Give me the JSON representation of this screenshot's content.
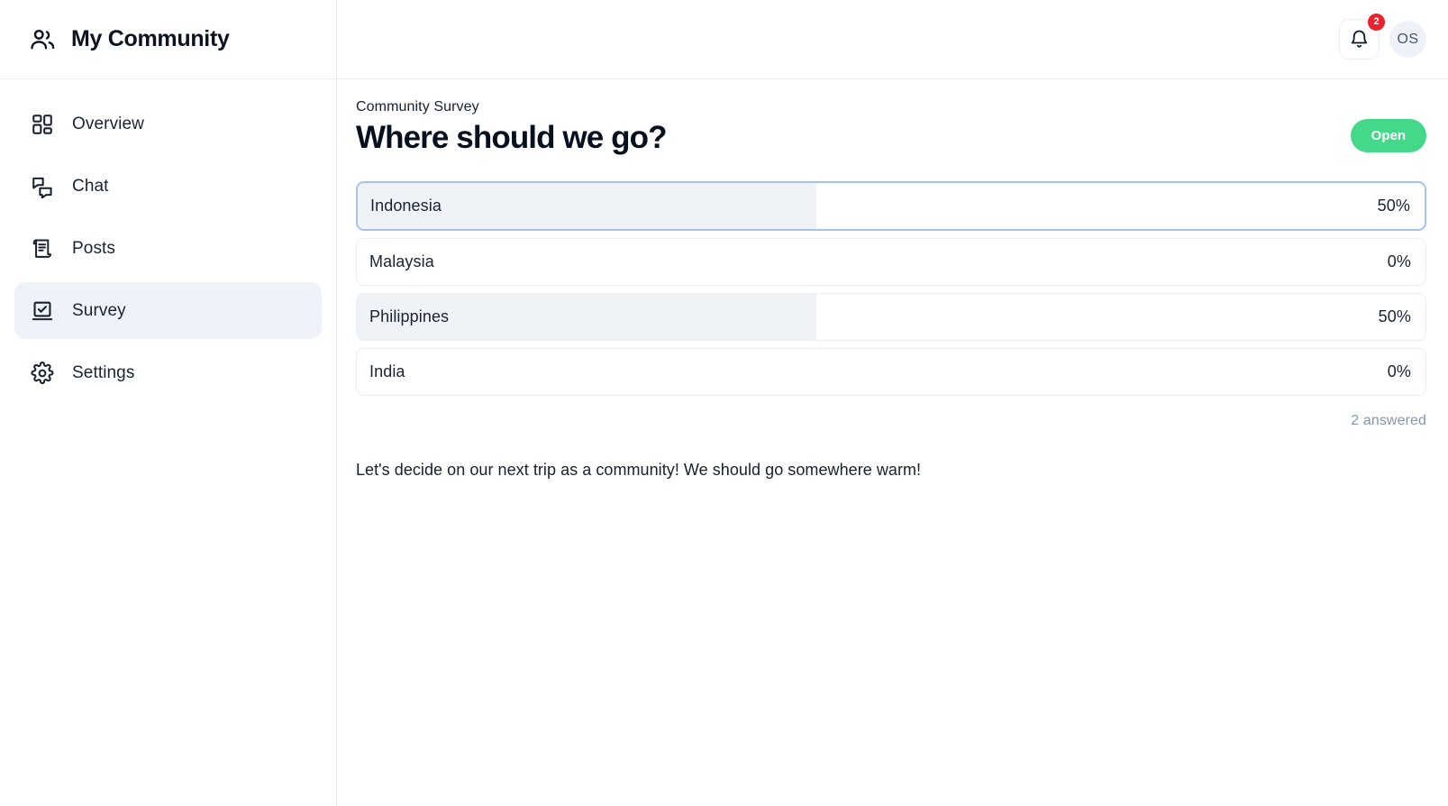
{
  "sidebar": {
    "brand": {
      "title": "My Community",
      "icon": "users-icon"
    },
    "items": [
      {
        "label": "Overview",
        "icon": "grid-icon",
        "active": false
      },
      {
        "label": "Chat",
        "icon": "chat-bubbles-icon",
        "active": false
      },
      {
        "label": "Posts",
        "icon": "scroll-document-icon",
        "active": false
      },
      {
        "label": "Survey",
        "icon": "ballot-check-icon",
        "active": true
      },
      {
        "label": "Settings",
        "icon": "gear-icon",
        "active": false
      }
    ]
  },
  "topbar": {
    "notifications": {
      "icon": "bell-icon",
      "badge": "2"
    },
    "avatar": {
      "initials": "OS"
    }
  },
  "survey": {
    "eyebrow": "Community Survey",
    "title": "Where should we go?",
    "status": "Open",
    "status_color": "#44d88a",
    "answered": "2 answered",
    "description": "Let's decide on our next trip as a community! We should go somewhere warm!",
    "options": [
      {
        "label": "Indonesia",
        "percent": "50%",
        "value": 50,
        "selected": true
      },
      {
        "label": "Malaysia",
        "percent": "0%",
        "value": 0,
        "selected": false
      },
      {
        "label": "Philippines",
        "percent": "50%",
        "value": 50,
        "selected": false
      },
      {
        "label": "India",
        "percent": "0%",
        "value": 0,
        "selected": false
      }
    ]
  }
}
